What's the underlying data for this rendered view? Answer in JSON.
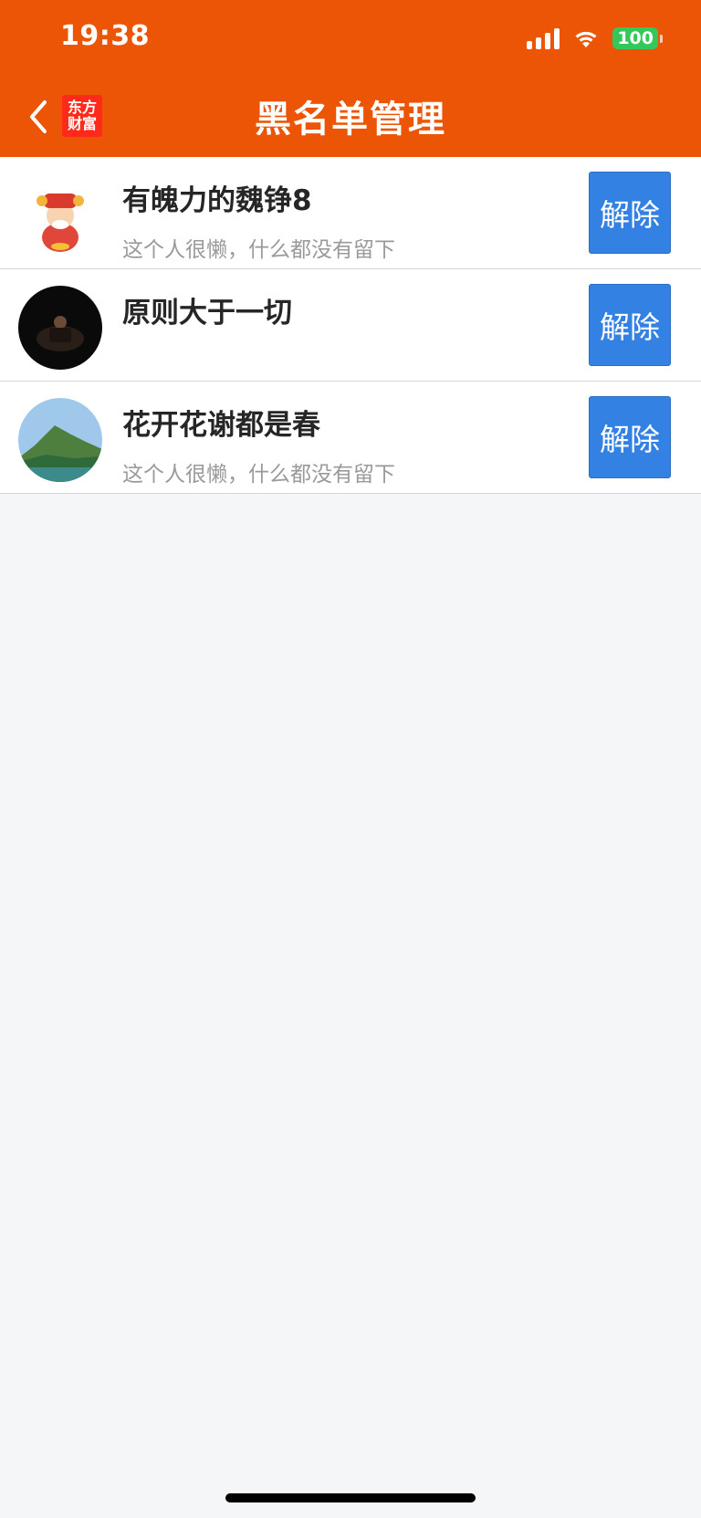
{
  "status_bar": {
    "time": "19:38",
    "battery": "100",
    "icons": [
      "signal-icon",
      "wifi-icon",
      "battery-icon"
    ]
  },
  "header": {
    "title": "黑名单管理",
    "back_icon": "chevron-left-icon",
    "logo_line1": "东方",
    "logo_line2": "财富"
  },
  "colors": {
    "header_bg": "#eb5505",
    "button_bg": "#3381e2",
    "page_bg": "#f5f6f8"
  },
  "blocked_users": [
    {
      "name": "有魄力的魏铮8",
      "bio": "这个人很懒，什么都没有留下",
      "action": "解除",
      "avatar": "cartoon-fortune-god-avatar"
    },
    {
      "name": "原则大于一切",
      "bio": "",
      "action": "解除",
      "avatar": "dark-photo-avatar"
    },
    {
      "name": "花开花谢都是春",
      "bio": "这个人很懒，什么都没有留下",
      "action": "解除",
      "avatar": "mountain-lake-avatar"
    }
  ]
}
